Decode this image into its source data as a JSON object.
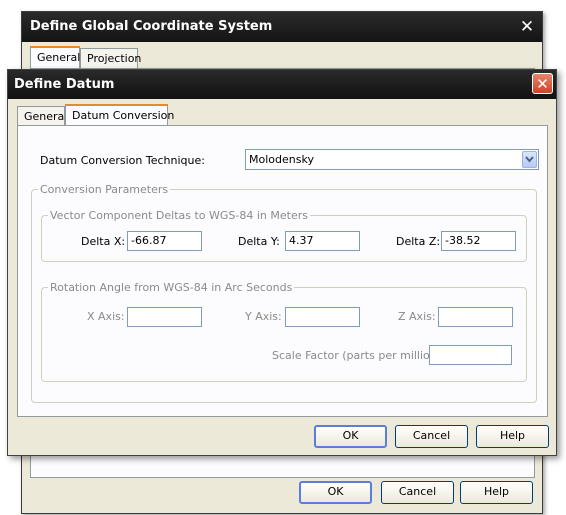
{
  "back_dialog": {
    "title": "Define Global Coordinate System",
    "tabs": [
      "General",
      "Projection"
    ],
    "buttons": {
      "ok": "OK",
      "cancel": "Cancel",
      "help": "Help"
    }
  },
  "front_dialog": {
    "title": "Define Datum",
    "tabs": [
      "General",
      "Datum Conversion"
    ],
    "technique": {
      "label": "Datum Conversion Technique:",
      "value": "Molodensky"
    },
    "conversion_parameters": {
      "title": "Conversion Parameters",
      "vector": {
        "title": "Vector Component Deltas to WGS-84 in Meters",
        "delta_x_label": "Delta X:",
        "delta_x": "-66.87",
        "delta_y_label": "Delta Y:",
        "delta_y": "4.37",
        "delta_z_label": "Delta Z:",
        "delta_z": "-38.52"
      },
      "rotation": {
        "title": "Rotation Angle from WGS-84 in Arc Seconds",
        "x_label": "X Axis:",
        "x_value": "",
        "y_label": "Y Axis:",
        "y_value": "",
        "z_label": "Z Axis:",
        "z_value": "",
        "scale_label": "Scale Factor (parts per million):",
        "scale_value": ""
      }
    },
    "buttons": {
      "ok": "OK",
      "cancel": "Cancel",
      "help": "Help"
    }
  },
  "icons": [
    "close-icon",
    "chevron-down-icon"
  ]
}
